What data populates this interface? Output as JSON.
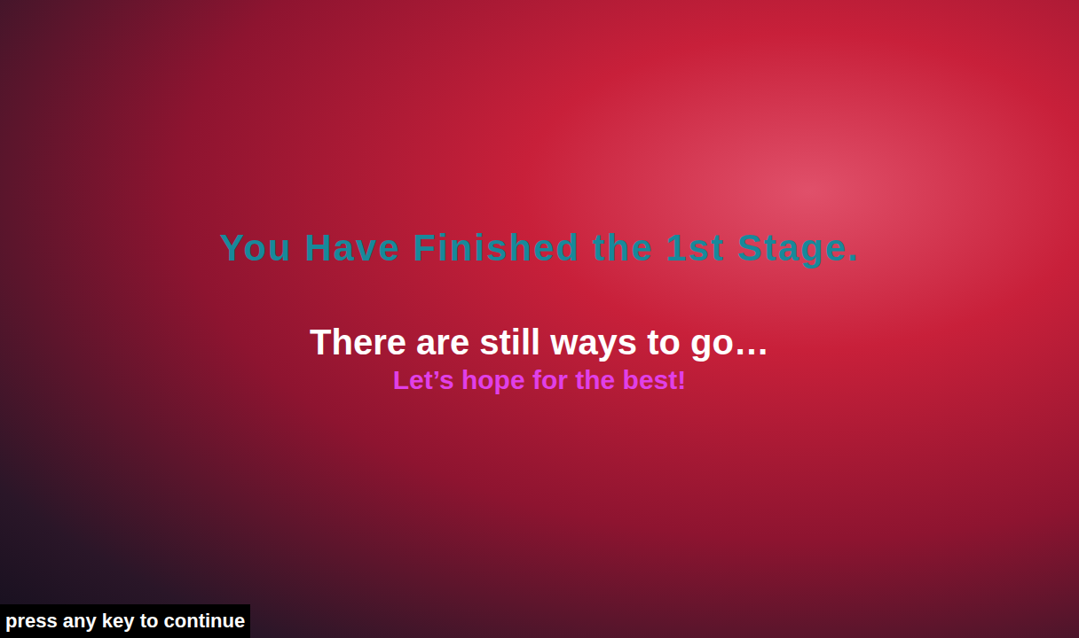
{
  "screen": {
    "title": "You Have Finished the 1st Stage.",
    "subtitle": "There are still ways to go…",
    "tagline": "Let’s hope for the best!",
    "prompt": "press any key to continue"
  }
}
